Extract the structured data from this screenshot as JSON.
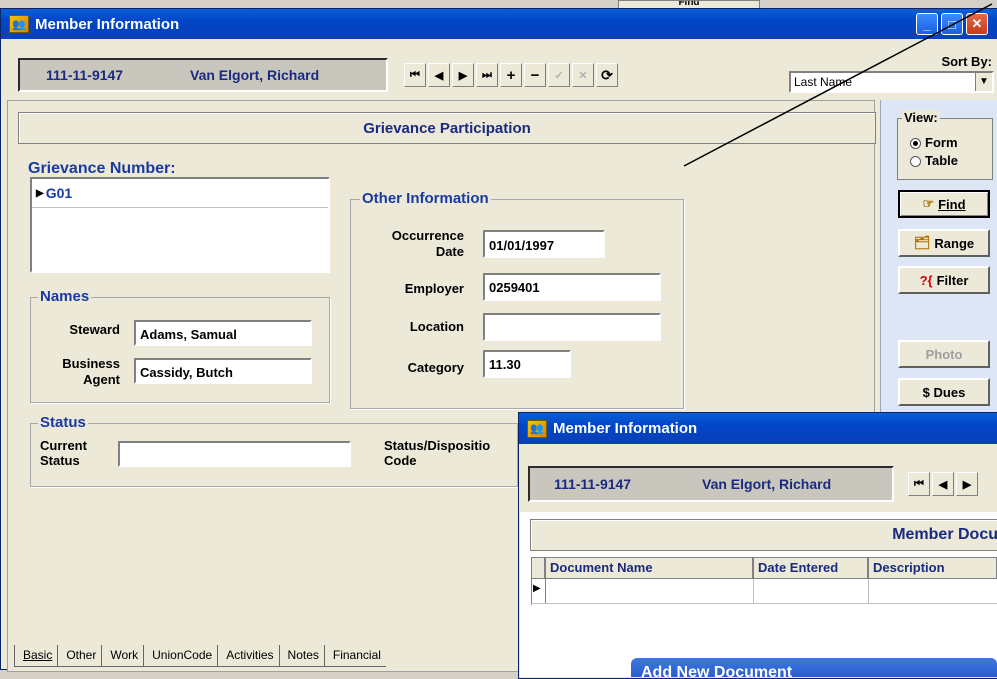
{
  "background": {
    "find_button_label": "Find"
  },
  "main_window": {
    "title": "Member Information",
    "id": "111-11-9147",
    "name": "Van Elgort, Richard",
    "sort_by_label": "Sort By:",
    "sort_by_value": "Last Name",
    "section_title": "Grievance Participation",
    "grievance_number_label": "Grievance Number:",
    "grievance_rows": [
      "G01"
    ],
    "other_info": {
      "legend": "Other Information",
      "occurrence_label": "Occurrence",
      "date_label": "Date",
      "occurrence_date": "01/01/1997",
      "employer_label": "Employer",
      "employer": "0259401",
      "location_label": "Location",
      "location": "",
      "category_label": "Category",
      "category": "11.30"
    },
    "names": {
      "legend": "Names",
      "steward_label": "Steward",
      "steward": "Adams, Samual",
      "business_label": "Business",
      "agent_label": "Agent",
      "business_agent": "Cassidy, Butch"
    },
    "status": {
      "legend": "Status",
      "current_label": "Current",
      "status_label": "Status",
      "current_status": "",
      "disposition_label": "Status/Dispositio",
      "code_label": "Code"
    },
    "view": {
      "label": "View:",
      "options": [
        "Form",
        "Table"
      ],
      "selected": "Form"
    },
    "side_buttons": {
      "find": "Find",
      "range": "Range",
      "filter": "Filter",
      "photo": "Photo",
      "dues": "$ Dues"
    },
    "tabs": [
      "Basic",
      "Other",
      "Work",
      "UnionCode",
      "Activities",
      "Notes",
      "Financial"
    ]
  },
  "second_window": {
    "title": "Member Information",
    "id": "111-11-9147",
    "name": "Van Elgort, Richard",
    "section_title": "Member Docu",
    "columns": [
      "Document Name",
      "Date Entered",
      "Description"
    ]
  },
  "dialog": {
    "title": "Add New Document"
  },
  "colors": {
    "title_blue": "#0046c7",
    "label_blue": "#1a3aa0",
    "window_bg": "#ece9d8",
    "close_red": "#c63a1c"
  }
}
